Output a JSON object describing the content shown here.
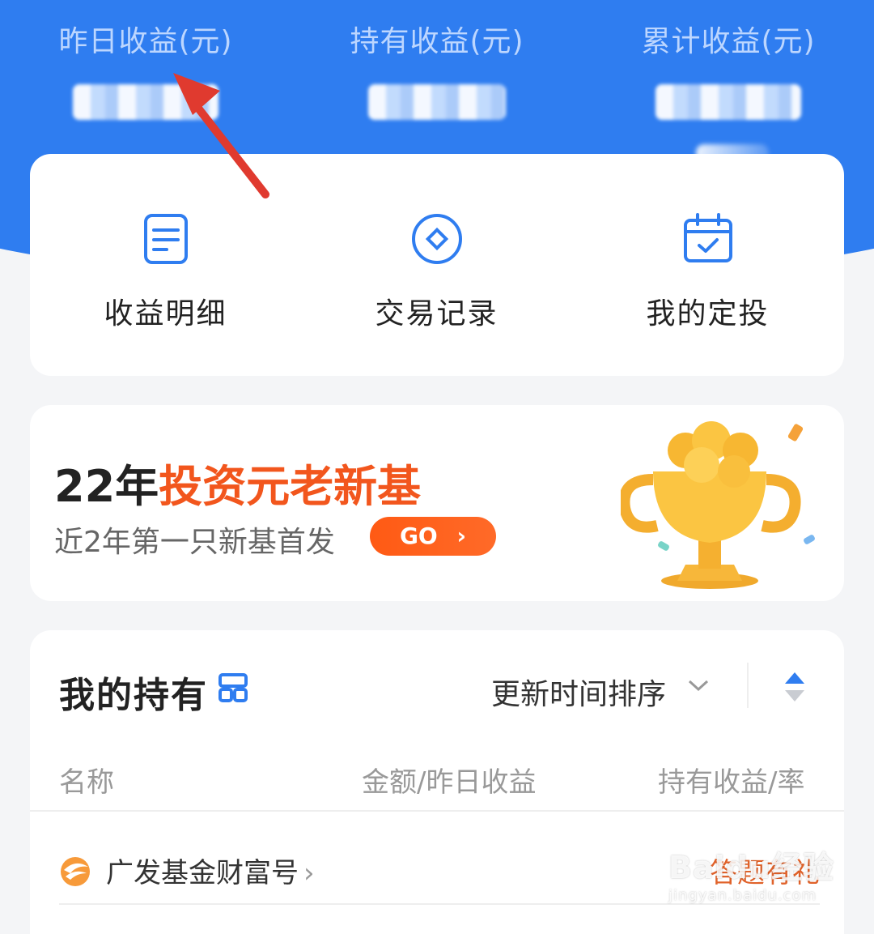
{
  "header": {
    "stats": [
      {
        "label": "昨日收益(元)"
      },
      {
        "label": "持有收益(元)"
      },
      {
        "label": "累计收益(元)"
      }
    ]
  },
  "quick_actions": [
    {
      "label": "收益明细",
      "icon": "document-icon"
    },
    {
      "label": "交易记录",
      "icon": "diamond-circle-icon"
    },
    {
      "label": "我的定投",
      "icon": "calendar-check-icon"
    }
  ],
  "banner": {
    "title_prefix": "22年",
    "title_highlight": "投资元老新基",
    "subtitle": "近2年第一只新基首发",
    "go_label": "GO",
    "go_arrow": "›"
  },
  "holdings": {
    "title": "我的持有",
    "sort_label": "更新时间排序",
    "columns": [
      "名称",
      "金额/昨日收益",
      "持有收益/率"
    ],
    "rows": [
      {
        "name": "广发基金财富号",
        "arrow": "›",
        "tag": "答题有礼"
      }
    ]
  },
  "colors": {
    "brand_blue": "#2f7df0",
    "accent_orange": "#f2561d",
    "annotation_red": "#e03a2f"
  },
  "watermark": {
    "main": "Baidu经验",
    "sub": "jingyan.baidu.com"
  }
}
